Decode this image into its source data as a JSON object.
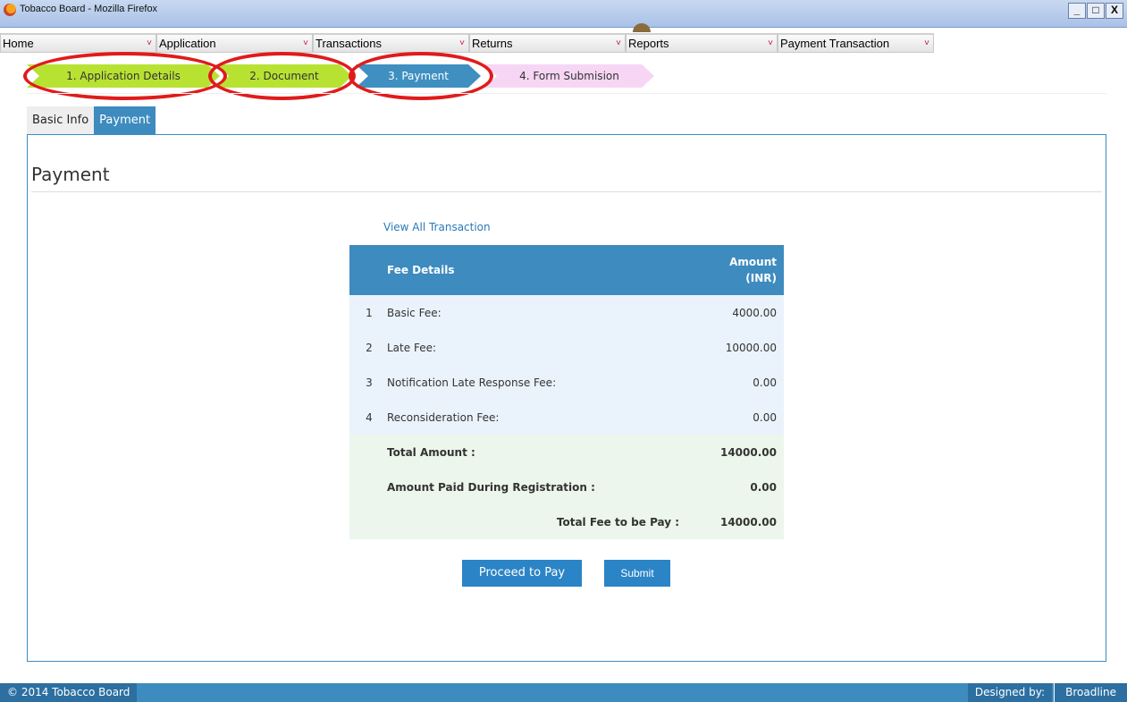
{
  "window": {
    "title": "Tobacco Board - Mozilla Firefox",
    "controls": [
      "_",
      "□",
      "X"
    ]
  },
  "menu": [
    {
      "label": "Home",
      "chevron": "˅"
    },
    {
      "label": "Application",
      "chevron": "˅"
    },
    {
      "label": "Transactions",
      "chevron": "˅"
    },
    {
      "label": "Returns",
      "chevron": "˅"
    },
    {
      "label": "Reports",
      "chevron": "˅"
    },
    {
      "label": "Payment Transaction",
      "chevron": "˅"
    }
  ],
  "steps": [
    {
      "label": "1. Application Details"
    },
    {
      "label": "2. Document"
    },
    {
      "label": "3. Payment"
    },
    {
      "label": "4. Form Submision"
    }
  ],
  "tabs": [
    {
      "label": "Basic Info"
    },
    {
      "label": "Payment"
    }
  ],
  "panel": {
    "title": "Payment",
    "view_all": "View All Transaction"
  },
  "fee_table": {
    "header_label": "Fee Details",
    "header_amount_line1": "Amount",
    "header_amount_line2": "(INR)",
    "items": [
      {
        "no": "1",
        "label": "Basic Fee:",
        "amount": "4000.00"
      },
      {
        "no": "2",
        "label": "Late Fee:",
        "amount": "10000.00"
      },
      {
        "no": "3",
        "label": "Notification Late Response Fee:",
        "amount": "0.00"
      },
      {
        "no": "4",
        "label": "Reconsideration Fee:",
        "amount": "0.00"
      }
    ],
    "total_label": "Total Amount :",
    "total_value": "14000.00",
    "paid_label": "Amount Paid During Registration :",
    "paid_value": "0.00",
    "payable_label": "Total Fee to be Pay :",
    "payable_value": "14000.00"
  },
  "buttons": {
    "proceed": "Proceed to Pay",
    "submit": "Submit"
  },
  "footer": {
    "copyright": "© 2014 Tobacco Board",
    "designed_by": "Designed by:",
    "brand": "Broadline"
  },
  "colors": {
    "accent": "#3d8bbf",
    "step_done": "#b8e232",
    "step_pending": "#f6d6f4",
    "annotation": "#e01b1b"
  }
}
